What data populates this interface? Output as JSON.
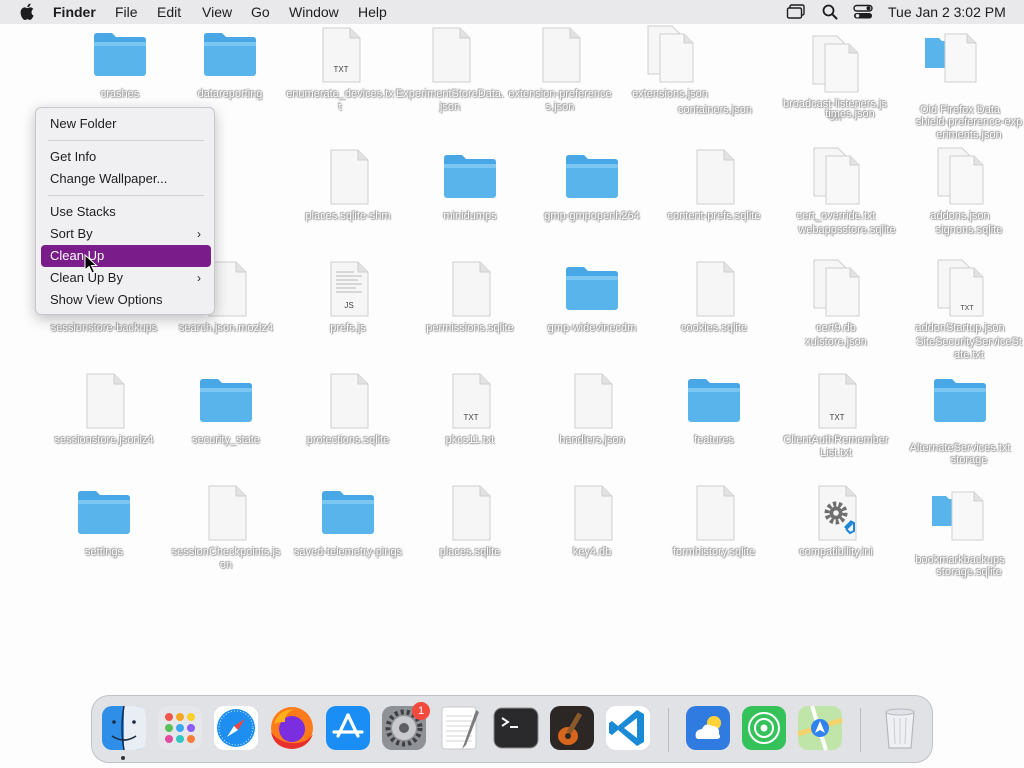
{
  "menubar": {
    "app_name": "Finder",
    "menus": [
      "File",
      "Edit",
      "View",
      "Go",
      "Window",
      "Help"
    ],
    "clock": "Tue Jan 2  3:02 PM"
  },
  "context_menu": {
    "new_folder": "New Folder",
    "get_info": "Get Info",
    "change_wallpaper": "Change Wallpaper...",
    "use_stacks": "Use Stacks",
    "sort_by": "Sort By",
    "clean_up": "Clean Up",
    "clean_up_by": "Clean Up By",
    "show_view_options": "Show View Options",
    "submenu_arrow": "›"
  },
  "desktop": {
    "crashes": "crashes",
    "datareporting": "datareporting",
    "enumerate_devices": "enumerate_devices.txt",
    "experiment_store": "ExperimentStoreData.json",
    "extension_prefs": "extension-preferences.json",
    "extensions_json": "extensions.json",
    "containers": "containers.json",
    "broadcast": "broadcast-listeners.json",
    "times_json": "times.json",
    "old_firefox": "Old Firefox Data",
    "shield_prefs": "shield-preference-experiments.json",
    "places_shm": "places.sqlite-shm",
    "minidumps": "minidumps",
    "gmp_openh264": "gmp-gmpopenh264",
    "content_prefs": "content-prefs.sqlite",
    "cert_override": "cert_override.txt",
    "webappsstore": "webappsstore.sqlite",
    "addons_json": "addons.json",
    "signons": "signons.sqlite",
    "sessionstore_backups": "sessionstore-backups",
    "search_json": "search.json.mozlz4",
    "prefs_js": "prefs.js",
    "permissions": "permissions.sqlite",
    "gmp_widevine": "gmp-widevinecdm",
    "cookies": "cookies.sqlite",
    "cert9": "cert9.db",
    "xulstore": "xulstore.json",
    "addon_startup": "addonStartup.json",
    "site_security": "SiteSecurityServiceState.txt",
    "sessionstore_jsonlz4": "sessionstore.jsonlz4",
    "security_state": "security_state",
    "protections": "protections.sqlite",
    "pkcs11": "pkcs11.txt",
    "handlers": "handlers.json",
    "features": "features",
    "client_auth": "ClientAuthRememberList.txt",
    "alternate_services": "AlternateServices.txt",
    "storage": "storage",
    "settings": "settings",
    "session_checkpoints": "sessionCheckpoints.json",
    "saved_telemetry": "saved-telemetry-pings",
    "places_sqlite": "places.sqlite",
    "key4": "key4.db",
    "formhistory": "formhistory.sqlite",
    "compatibility": "compatibility.ini",
    "bookmarkbackups": "bookmarkbackups",
    "storage_sqlite": "storage.sqlite"
  },
  "file_tags": {
    "txt": "TXT",
    "js": "JS"
  },
  "dock": {
    "settings_badge": "1"
  },
  "colors": {
    "folder": "#5ab4ec",
    "accent": "#7a1d8a",
    "badge": "#f24a3c"
  }
}
